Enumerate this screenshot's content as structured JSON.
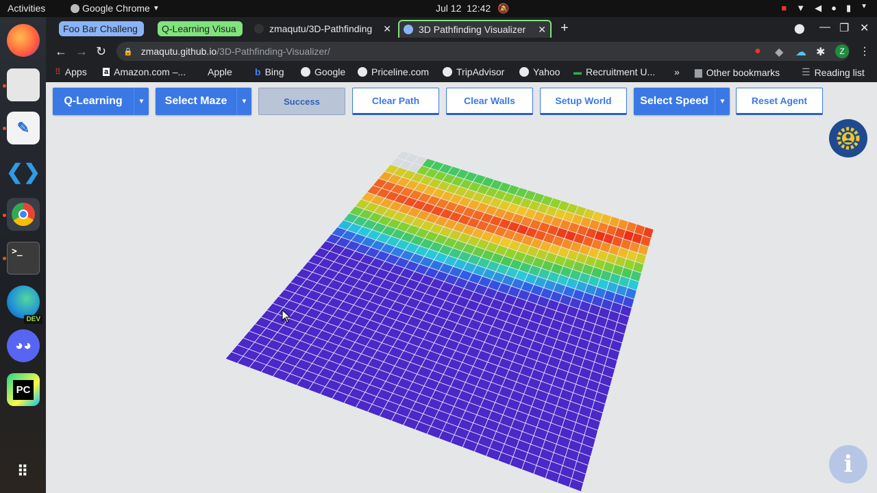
{
  "topbar": {
    "activities": "Activities",
    "app_name": "Google Chrome",
    "date": "Jul 12",
    "time": "12:42"
  },
  "dock": {
    "items": [
      "firefox-icon",
      "files-icon",
      "text-editor-icon",
      "vscode-icon",
      "chrome-icon",
      "terminal-icon",
      "edge-dev-icon",
      "discord-icon",
      "pycharm-icon",
      "apps-grid-icon"
    ],
    "edge_badge": "DEV",
    "pycharm_label": "PC",
    "terminal_label": ">_"
  },
  "tabs": [
    {
      "title": "Foo Bar Challeng"
    },
    {
      "title": "Q-Learning Visua"
    },
    {
      "title": "zmaqutu/3D-Pathfinding"
    },
    {
      "title": "3D Pathfinding Visualizer"
    }
  ],
  "url": {
    "domain": "zmaqutu.github.io",
    "path": "/3D-Pathfinding-Visualizer/"
  },
  "profile_letter": "Z",
  "bookmarks": {
    "items": [
      "Apps",
      "Amazon.com –...",
      "Apple",
      "Bing",
      "Google",
      "Priceline.com",
      "TripAdvisor",
      "Yahoo",
      "Recruitment U..."
    ],
    "more": "»",
    "other": "Other bookmarks",
    "reading_list": "Reading list"
  },
  "toolbar": {
    "algorithm": "Q-Learning",
    "select_maze": "Select Maze",
    "status": "Success",
    "clear_path": "Clear Path",
    "clear_walls": "Clear Walls",
    "setup_world": "Setup World",
    "select_speed": "Select Speed",
    "reset_agent": "Reset Agent"
  },
  "info_button": "i",
  "colors": {
    "accent": "#3a78e6",
    "page_bg": "#e4e6e8",
    "gear_bg": "#1f4a8f"
  }
}
